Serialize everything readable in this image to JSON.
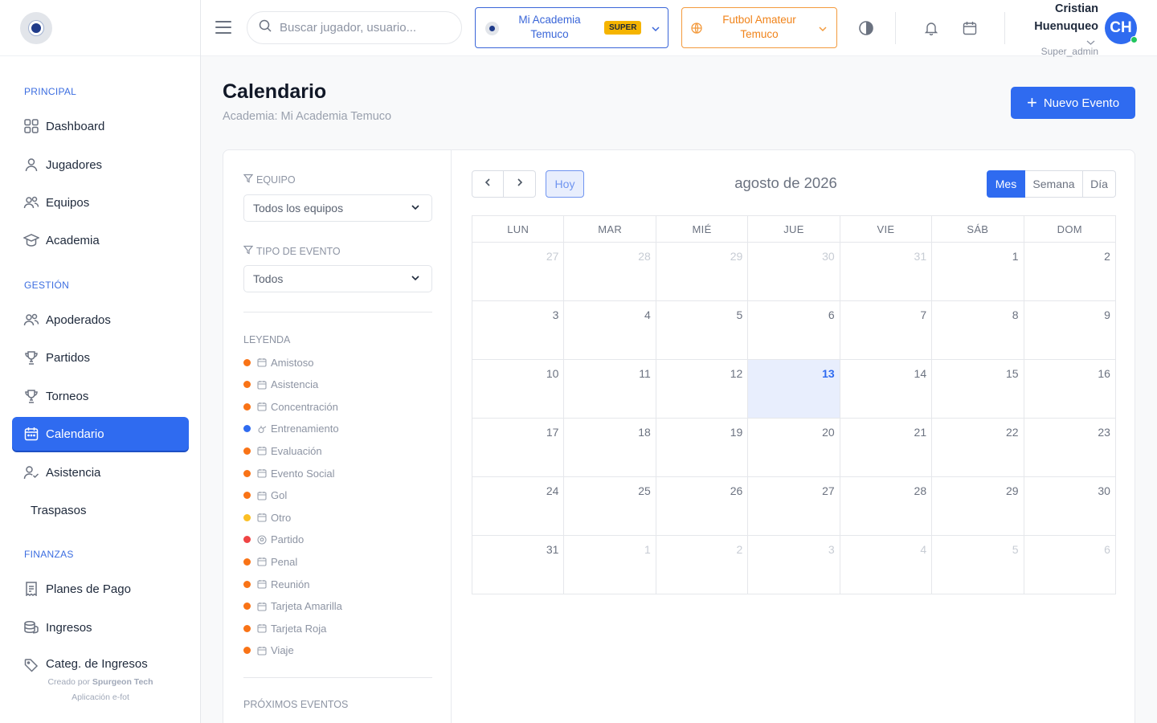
{
  "sidebar": {
    "sections": [
      "PRINCIPAL",
      "GESTIÓN",
      "FINANZAS"
    ],
    "items": [
      {
        "label": "Dashboard",
        "icon": "grid-icon"
      },
      {
        "label": "Jugadores",
        "icon": "user-icon"
      },
      {
        "label": "Equipos",
        "icon": "users-icon"
      },
      {
        "label": "Academia",
        "icon": "graduation-cap-icon"
      },
      {
        "label": "Apoderados",
        "icon": "users-icon"
      },
      {
        "label": "Partidos",
        "icon": "trophy-icon"
      },
      {
        "label": "Torneos",
        "icon": "trophy-icon"
      },
      {
        "label": "Calendario",
        "icon": "calendar-icon",
        "active": true
      },
      {
        "label": "Asistencia",
        "icon": "user-check-icon"
      },
      {
        "label": "Traspasos",
        "icon": ""
      },
      {
        "label": "Planes de Pago",
        "icon": "receipt-icon"
      },
      {
        "label": "Ingresos",
        "icon": "coins-icon"
      },
      {
        "label": "Categ. de Ingresos",
        "icon": "tag-icon"
      }
    ],
    "footer_prefix": "Creado por",
    "footer_brand": "Spurgeon Tech",
    "footer_app": "Aplicación e-fot"
  },
  "header": {
    "search_placeholder": "Buscar jugador, usuario...",
    "academy_line1": "Mi Academia",
    "academy_line2": "Temuco",
    "academy_badge": "SUPER",
    "club_line1": "Futbol Amateur",
    "club_line2": "Temuco",
    "user_first": "Cristian",
    "user_last": "Huenuqueo",
    "user_role": "Super_admin",
    "avatar_initials": "CH"
  },
  "page": {
    "title": "Calendario",
    "subtitle": "Academia: Mi Academia Temuco",
    "new_event_label": "Nuevo Evento"
  },
  "filters": {
    "team_label": "EQUIPO",
    "team_value": "Todos los equipos",
    "type_label": "TIPO DE EVENTO",
    "type_value": "Todos",
    "legend_label": "LEYENDA",
    "upcoming_label": "PRÓXIMOS EVENTOS",
    "legend": [
      {
        "label": "Amistoso",
        "color": "#f97316",
        "icon": "calendar-icon"
      },
      {
        "label": "Asistencia",
        "color": "#f97316",
        "icon": "calendar-icon"
      },
      {
        "label": "Concentración",
        "color": "#f97316",
        "icon": "calendar-icon"
      },
      {
        "label": "Entrenamiento",
        "color": "#2f6bf0",
        "icon": "whistle-icon"
      },
      {
        "label": "Evaluación",
        "color": "#f97316",
        "icon": "calendar-icon"
      },
      {
        "label": "Evento Social",
        "color": "#f97316",
        "icon": "calendar-icon"
      },
      {
        "label": "Gol",
        "color": "#f97316",
        "icon": "calendar-icon"
      },
      {
        "label": "Otro",
        "color": "#fbbf24",
        "icon": "calendar-icon"
      },
      {
        "label": "Partido",
        "color": "#ef4444",
        "icon": "ball-icon"
      },
      {
        "label": "Penal",
        "color": "#f97316",
        "icon": "calendar-icon"
      },
      {
        "label": "Reunión",
        "color": "#f97316",
        "icon": "calendar-icon"
      },
      {
        "label": "Tarjeta Amarilla",
        "color": "#f97316",
        "icon": "calendar-icon"
      },
      {
        "label": "Tarjeta Roja",
        "color": "#f97316",
        "icon": "calendar-icon"
      },
      {
        "label": "Viaje",
        "color": "#f97316",
        "icon": "calendar-icon"
      }
    ]
  },
  "calendar": {
    "today_label": "Hoy",
    "month_title": "agosto de 2026",
    "views": [
      "Mes",
      "Semana",
      "Día"
    ],
    "active_view": "Mes",
    "weekdays": [
      "LUN",
      "MAR",
      "MIÉ",
      "JUE",
      "VIE",
      "SÁB",
      "DOM"
    ],
    "today": "13",
    "weeks": [
      [
        {
          "d": "27",
          "o": true
        },
        {
          "d": "28",
          "o": true
        },
        {
          "d": "29",
          "o": true
        },
        {
          "d": "30",
          "o": true
        },
        {
          "d": "31",
          "o": true
        },
        {
          "d": "1"
        },
        {
          "d": "2"
        }
      ],
      [
        {
          "d": "3"
        },
        {
          "d": "4"
        },
        {
          "d": "5"
        },
        {
          "d": "6"
        },
        {
          "d": "7"
        },
        {
          "d": "8"
        },
        {
          "d": "9"
        }
      ],
      [
        {
          "d": "10"
        },
        {
          "d": "11"
        },
        {
          "d": "12"
        },
        {
          "d": "13",
          "t": true
        },
        {
          "d": "14"
        },
        {
          "d": "15"
        },
        {
          "d": "16"
        }
      ],
      [
        {
          "d": "17"
        },
        {
          "d": "18"
        },
        {
          "d": "19"
        },
        {
          "d": "20"
        },
        {
          "d": "21"
        },
        {
          "d": "22"
        },
        {
          "d": "23"
        }
      ],
      [
        {
          "d": "24"
        },
        {
          "d": "25"
        },
        {
          "d": "26"
        },
        {
          "d": "27"
        },
        {
          "d": "28"
        },
        {
          "d": "29"
        },
        {
          "d": "30"
        }
      ],
      [
        {
          "d": "31"
        },
        {
          "d": "1",
          "o": true
        },
        {
          "d": "2",
          "o": true
        },
        {
          "d": "3",
          "o": true
        },
        {
          "d": "4",
          "o": true
        },
        {
          "d": "5",
          "o": true
        },
        {
          "d": "6",
          "o": true
        }
      ]
    ]
  }
}
